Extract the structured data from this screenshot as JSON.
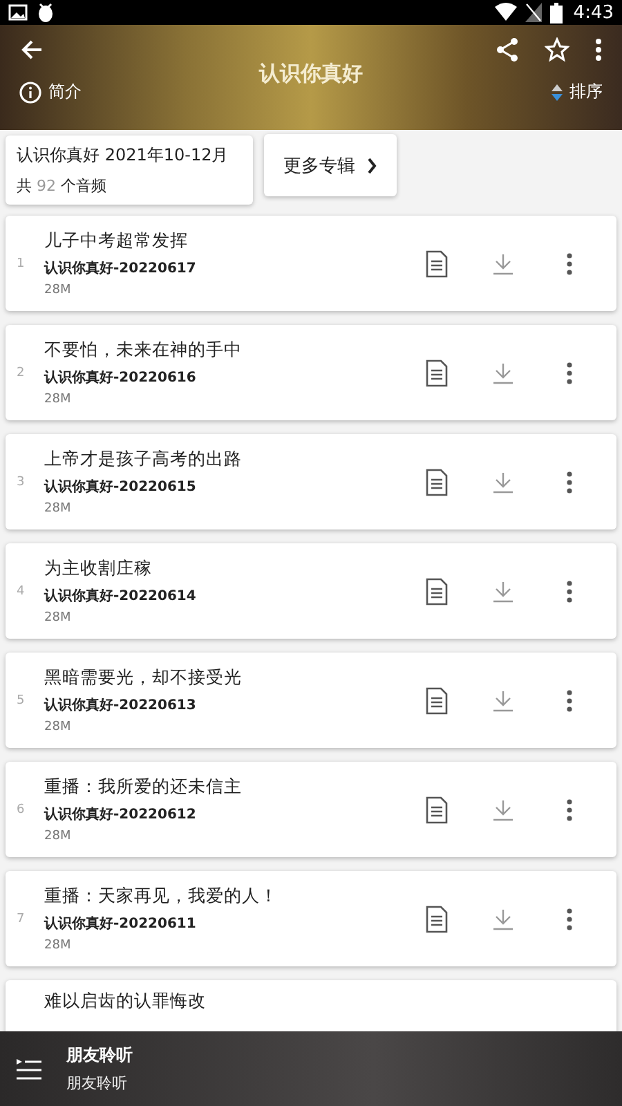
{
  "status_bar": {
    "time": "4:43"
  },
  "header": {
    "title": "认识你真好",
    "intro": "简介",
    "sort": "排序"
  },
  "album": {
    "title": "认识你真好 2021年10-12月",
    "count_prefix": "共",
    "count": "92",
    "count_suffix": "个音频",
    "more": "更多专辑"
  },
  "episodes": [
    {
      "number": "1",
      "title": "儿子中考超常发挥",
      "subtitle": "认识你真好-20220617",
      "size": "28M"
    },
    {
      "number": "2",
      "title": "不要怕，未来在神的手中",
      "subtitle": "认识你真好-20220616",
      "size": "28M"
    },
    {
      "number": "3",
      "title": "上帝才是孩子高考的出路",
      "subtitle": "认识你真好-20220615",
      "size": "28M"
    },
    {
      "number": "4",
      "title": "为主收割庄稼",
      "subtitle": "认识你真好-20220614",
      "size": "28M"
    },
    {
      "number": "5",
      "title": "黑暗需要光，却不接受光",
      "subtitle": "认识你真好-20220613",
      "size": "28M"
    },
    {
      "number": "6",
      "title": "重播：我所爱的还未信主",
      "subtitle": "认识你真好-20220612",
      "size": "28M"
    },
    {
      "number": "7",
      "title": "重播：天家再见，我爱的人！",
      "subtitle": "认识你真好-20220611",
      "size": "28M"
    },
    {
      "title": "难以启齿的认罪悔改"
    }
  ],
  "player": {
    "title": "朋友聆听",
    "subtitle": "朋友聆听"
  }
}
